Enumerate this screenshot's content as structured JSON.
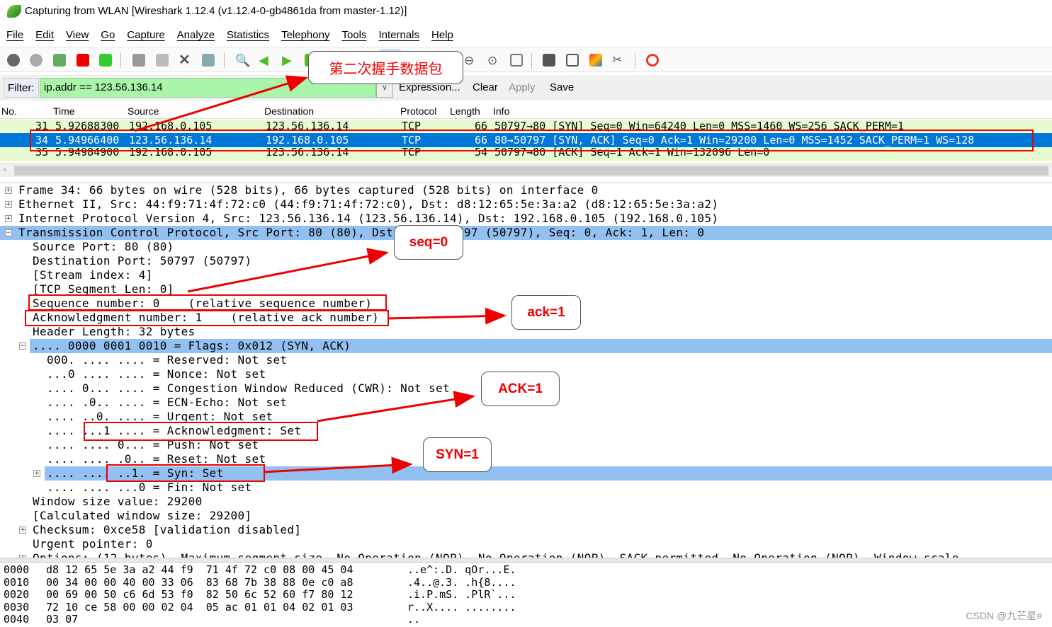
{
  "window": {
    "title": "Capturing from WLAN    [Wireshark 1.12.4  (v1.12.4-0-gb4861da from master-1.12)]"
  },
  "menu": [
    "File",
    "Edit",
    "View",
    "Go",
    "Capture",
    "Analyze",
    "Statistics",
    "Telephony",
    "Tools",
    "Internals",
    "Help"
  ],
  "filter": {
    "label": "Filter:",
    "value": "ip.addr == 123.56.136.14",
    "expression": "Expression...",
    "clear": "Clear",
    "apply": "Apply",
    "save": "Save"
  },
  "packet_list": {
    "columns": [
      "No.",
      "Time",
      "Source",
      "Destination",
      "Protocol",
      "Length",
      "Info"
    ],
    "rows": [
      {
        "no": "31",
        "time": "5.92688300",
        "src": "192.168.0.105",
        "dst": "123.56.136.14",
        "proto": "TCP",
        "len": "66",
        "info": "50797→80 [SYN] Seq=0 Win=64240 Len=0 MSS=1460 WS=256 SACK_PERM=1"
      },
      {
        "no": "34",
        "time": "5.94966400",
        "src": "123.56.136.14",
        "dst": "192.168.0.105",
        "proto": "TCP",
        "len": "66",
        "info": "80→50797 [SYN, ACK] Seq=0 Ack=1 Win=29200 Len=0 MSS=1452 SACK_PERM=1 WS=128"
      },
      {
        "no": "35",
        "time": "5.94984900",
        "src": "192.168.0.105",
        "dst": "123.56.136.14",
        "proto": "TCP",
        "len": "54",
        "info": "50797→80 [ACK] Seq=1 Ack=1 Win=132096 Len=0"
      }
    ],
    "selected_row": "34"
  },
  "detail": [
    "Frame 34: 66 bytes on wire (528 bits), 66 bytes captured (528 bits) on interface 0",
    "Ethernet II, Src: 44:f9:71:4f:72:c0 (44:f9:71:4f:72:c0), Dst: d8:12:65:5e:3a:a2 (d8:12:65:5e:3a:a2)",
    "Internet Protocol Version 4, Src: 123.56.136.14 (123.56.136.14), Dst: 192.168.0.105 (192.168.0.105)",
    "Transmission Control Protocol, Src Port: 80 (80), Dst Port: 50797 (50797), Seq: 0, Ack: 1, Len: 0",
    "Source Port: 80 (80)",
    "Destination Port: 50797 (50797)",
    "[Stream index: 4]",
    "[TCP Segment Len: 0]",
    "Sequence number: 0    (relative sequence number)",
    "Acknowledgment number: 1    (relative ack number)",
    "Header Length: 32 bytes",
    ".... 0000 0001 0010 = Flags: 0x012 (SYN, ACK)",
    "000. .... .... = Reserved: Not set",
    "...0 .... .... = Nonce: Not set",
    ".... 0... .... = Congestion Window Reduced (CWR): Not set",
    ".... .0.. .... = ECN-Echo: Not set",
    ".... ..0. .... = Urgent: Not set",
    ".... ...1 .... = Acknowledgment: Set",
    ".... .... 0... = Push: Not set",
    ".... .... .0.. = Reset: Not set",
    ".... .... ..1. = Syn: Set",
    ".... .... ...0 = Fin: Not set",
    "Window size value: 29200",
    "[Calculated window size: 29200]",
    "Checksum: 0xce58 [validation disabled]",
    "Urgent pointer: 0",
    "Options: (12 bytes), Maximum segment size, No-Operation (NOP), No-Operation (NOP), SACK permitted, No-Operation (NOP), Window scale"
  ],
  "hex": [
    {
      "off": "0000",
      "bytes": "d8 12 65 5e 3a a2 44 f9  71 4f 72 c0 08 00 45 04",
      "ascii": "..e^:.D. qOr...E."
    },
    {
      "off": "0010",
      "bytes": "00 34 00 00 40 00 33 06  83 68 7b 38 88 0e c0 a8",
      "ascii": ".4..@.3. .h{8...."
    },
    {
      "off": "0020",
      "bytes": "00 69 00 50 c6 6d 53 f0  82 50 6c 52 60 f7 80 12",
      "ascii": ".i.P.mS. .PlR`..."
    },
    {
      "off": "0030",
      "bytes": "72 10 ce 58 00 00 02 04  05 ac 01 01 04 02 01 03",
      "ascii": "r..X.... ........"
    },
    {
      "off": "0040",
      "bytes": "03 07",
      "ascii": ".."
    }
  ],
  "annotations": {
    "second_handshake": "第二次握手数据包",
    "seq": "seq=0",
    "ack": "ack=1",
    "ack_flag": "ACK=1",
    "syn_flag": "SYN=1"
  },
  "watermark": "CSDN @九芒星#",
  "colors": {
    "selected_row": "#0078d7",
    "tcp_row": "#e7fbd0",
    "highlight": "#92c0f0",
    "filter_ok": "#a9f5a9",
    "annotation": "#ee0000"
  }
}
